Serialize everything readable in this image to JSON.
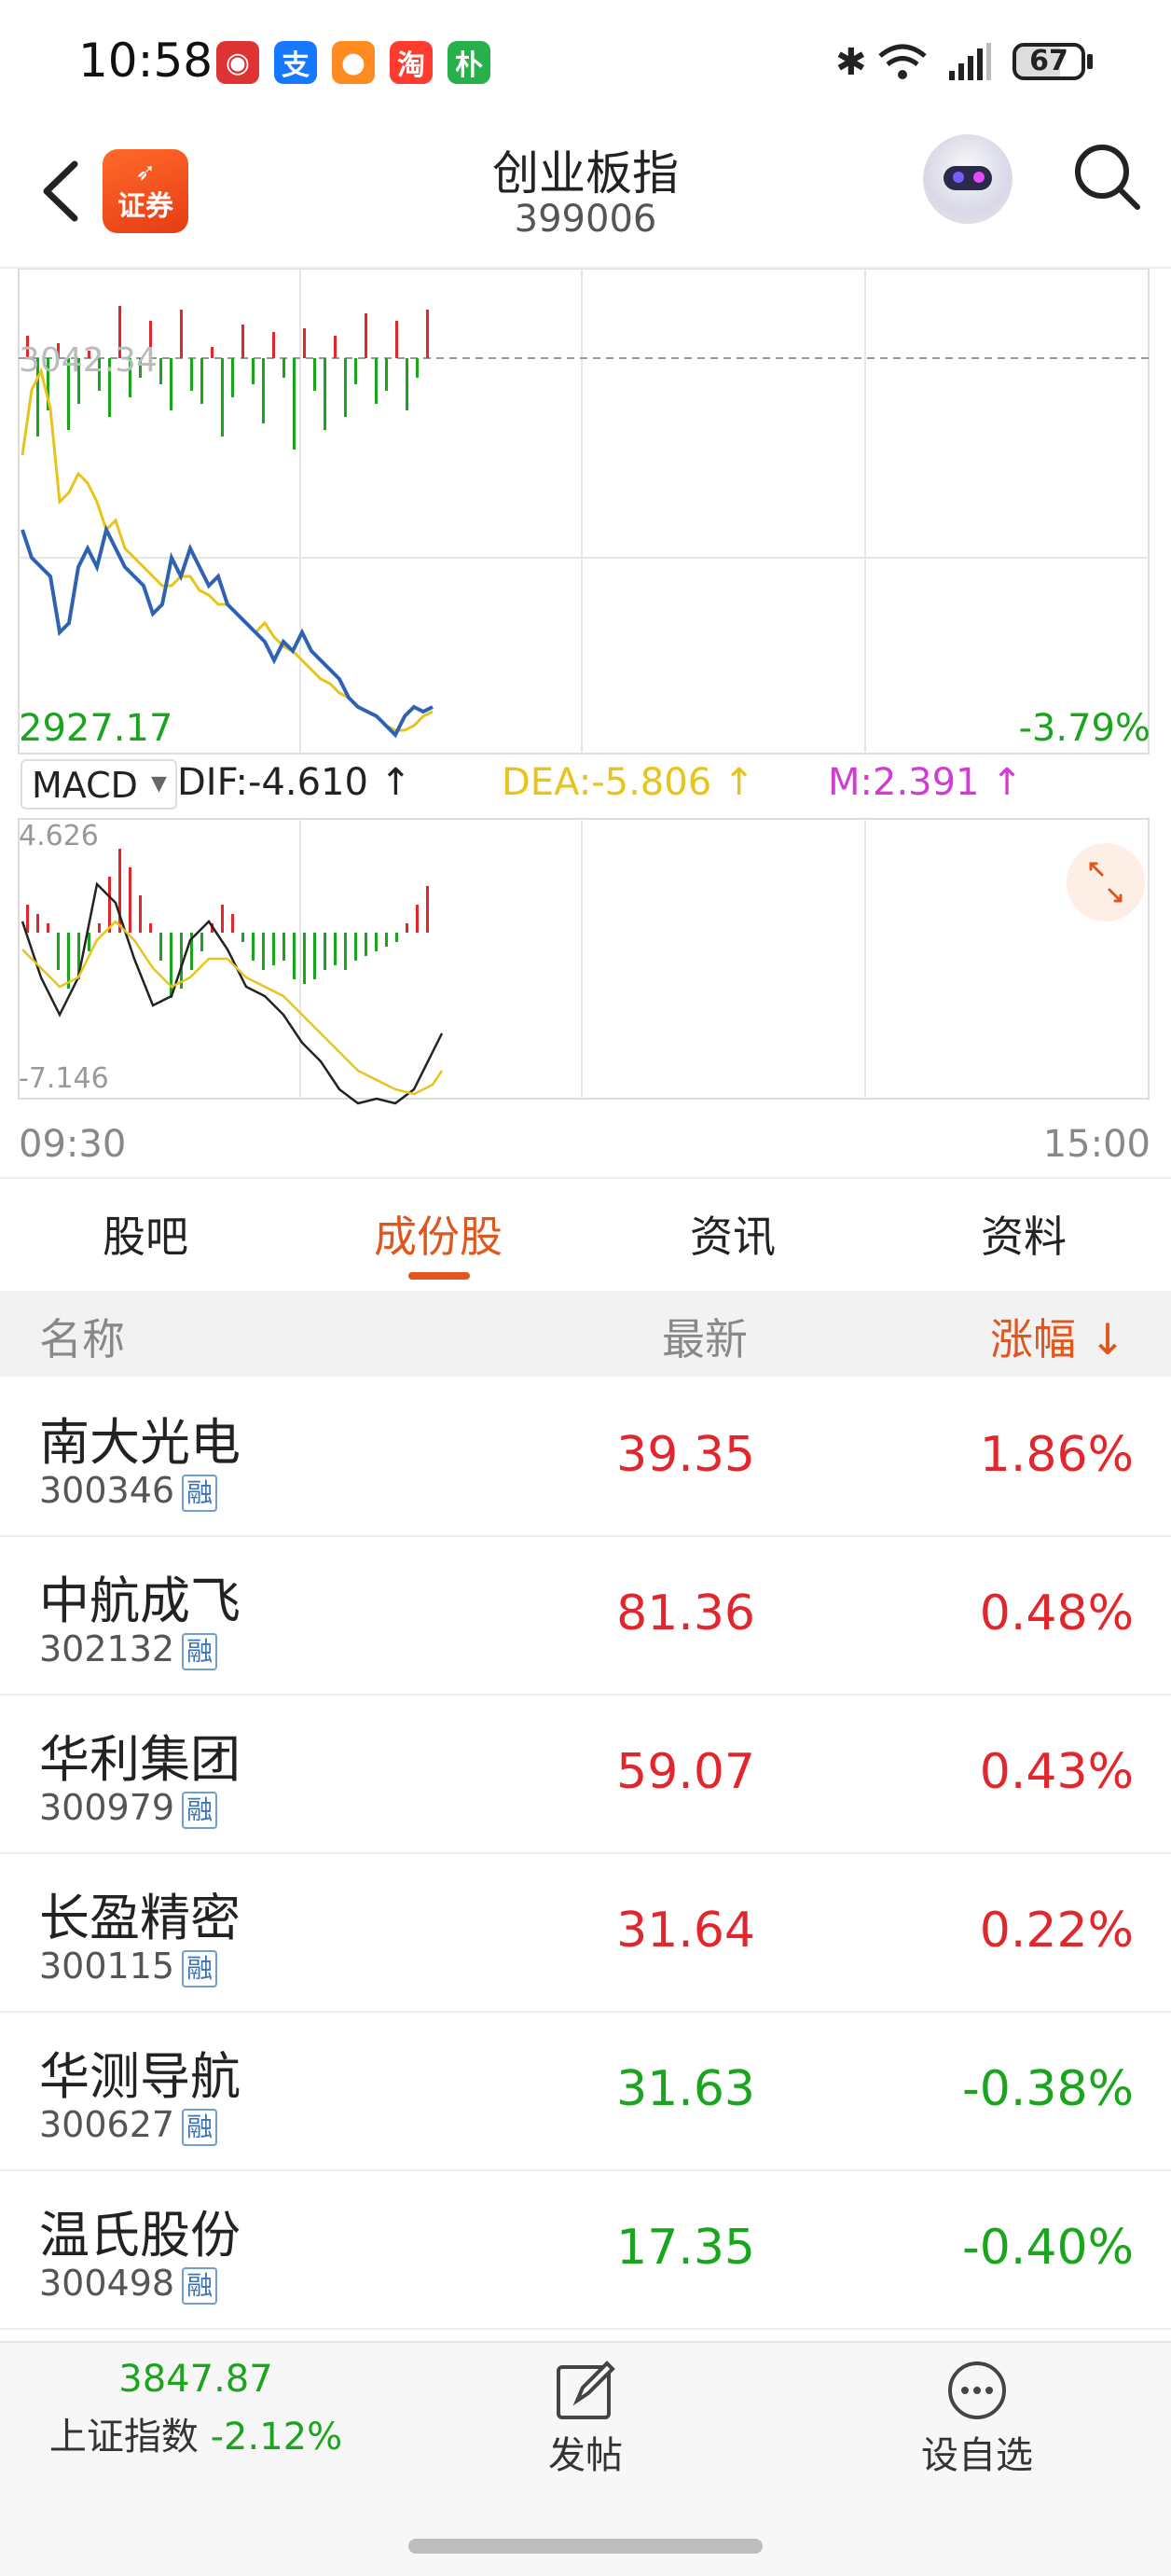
{
  "status_bar": {
    "time": "10:58",
    "apps": [
      {
        "name": "stock-app-icon",
        "glyph": "◉",
        "color": "#d33"
      },
      {
        "name": "alipay-icon",
        "glyph": "支",
        "color": "#1677ff"
      },
      {
        "name": "chat-app-icon",
        "glyph": "●",
        "color": "#ff8a1f"
      },
      {
        "name": "taobao-icon",
        "glyph": "淘",
        "color": "#ff3b2f"
      },
      {
        "name": "pu-app-icon",
        "glyph": "朴",
        "color": "#28b04b"
      }
    ],
    "battery": "67"
  },
  "header": {
    "title": "创业板指",
    "code": "399006",
    "logo_text": "证券"
  },
  "chart": {
    "base_price": "3042.34",
    "low_price": "2927.17",
    "change_pct": "-3.79%",
    "macd_selector": "MACD",
    "dif": "DIF:-4.610",
    "dea": "DEA:-5.806",
    "m": "M:2.391",
    "macd_high": "4.626",
    "macd_low": "-7.146",
    "time_start": "09:30",
    "time_end": "15:00"
  },
  "tabs": [
    {
      "label": "股吧",
      "active": false
    },
    {
      "label": "成份股",
      "active": true
    },
    {
      "label": "资讯",
      "active": false
    },
    {
      "label": "资料",
      "active": false
    }
  ],
  "list_header": {
    "name": "名称",
    "latest": "最新",
    "change": "涨幅",
    "sort_arrow": "↓"
  },
  "rows": [
    {
      "name": "南大光电",
      "code": "300346",
      "badge": "融",
      "price": "39.35",
      "pct": "1.86%",
      "dir": "up"
    },
    {
      "name": "中航成飞",
      "code": "302132",
      "badge": "融",
      "price": "81.36",
      "pct": "0.48%",
      "dir": "up"
    },
    {
      "name": "华利集团",
      "code": "300979",
      "badge": "融",
      "price": "59.07",
      "pct": "0.43%",
      "dir": "up"
    },
    {
      "name": "长盈精密",
      "code": "300115",
      "badge": "融",
      "price": "31.64",
      "pct": "0.22%",
      "dir": "up"
    },
    {
      "name": "华测导航",
      "code": "300627",
      "badge": "融",
      "price": "31.63",
      "pct": "-0.38%",
      "dir": "down"
    },
    {
      "name": "温氏股份",
      "code": "300498",
      "badge": "融",
      "price": "17.35",
      "pct": "-0.40%",
      "dir": "down"
    }
  ],
  "bottom_bar": {
    "index_value": "3847.87",
    "index_name": "上证指数",
    "index_change": "-2.12%",
    "post_label": "发帖",
    "watchlist_label": "设自选"
  },
  "colors": {
    "accent": "#e0561c",
    "up": "#e1262c",
    "down": "#1ba51e",
    "dea": "#e8c41a",
    "m": "#d33cd3",
    "price_line": "#2f62b0"
  }
}
